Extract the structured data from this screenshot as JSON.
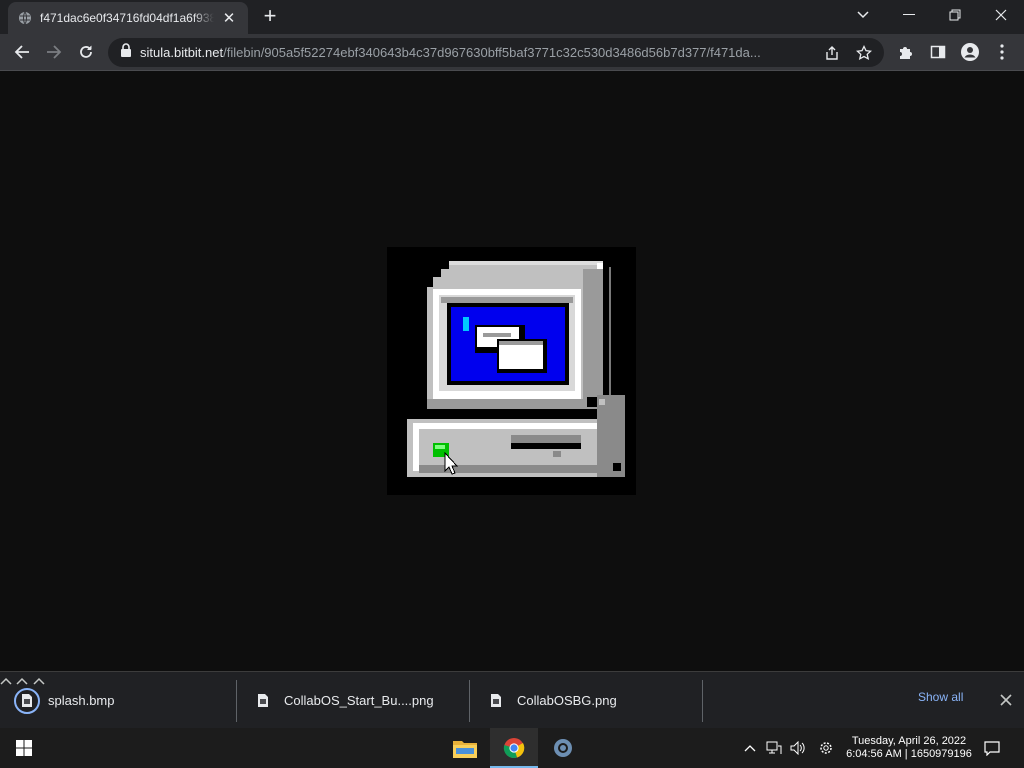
{
  "browser": {
    "tab": {
      "title": "f471dac6e0f34716fd04df1a6f938"
    },
    "url": {
      "host": "situla.bitbit.net",
      "path": "/filebin/905a5f52274ebf340643b4c37d967630bff5baf3771c32c530d3486d56b7d377/f471da..."
    }
  },
  "downloads": {
    "items": [
      {
        "name": "splash.bmp"
      },
      {
        "name": "CollabOS_Start_Bu....png"
      },
      {
        "name": "CollabOSBG.png"
      }
    ],
    "show_all": "Show all"
  },
  "taskbar": {
    "apps": [
      {
        "name": "File Explorer",
        "icon": "folder-icon"
      },
      {
        "name": "Google Chrome",
        "icon": "chrome-icon",
        "active": true
      },
      {
        "name": "Settings",
        "icon": "settings-app-icon"
      }
    ],
    "clock": {
      "date": "Tuesday, April 26, 2022",
      "time": "6:04:56 AM | 1650979196"
    }
  },
  "colors": {
    "page_bg": "#0e0e0e",
    "tabbar_bg": "#202124",
    "toolbar_bg": "#35363a",
    "link": "#8ab4f8",
    "screen_blue": "#0000ee",
    "power_led": "#00c000"
  }
}
